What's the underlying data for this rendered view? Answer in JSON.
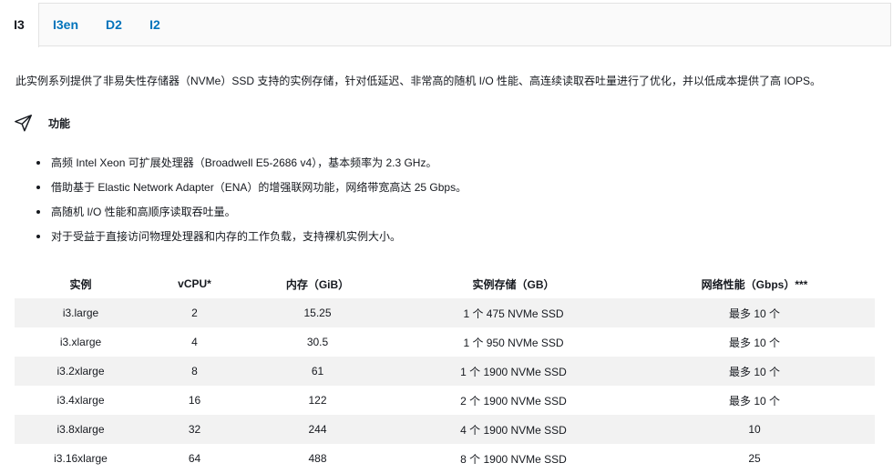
{
  "tabs": [
    {
      "label": "I3",
      "active": true
    },
    {
      "label": "I3en",
      "active": false
    },
    {
      "label": "D2",
      "active": false
    },
    {
      "label": "I2",
      "active": false
    }
  ],
  "intro": "此实例系列提供了非易失性存储器（NVMe）SSD 支持的实例存储，针对低延迟、非常高的随机 I/O 性能、高连续读取吞吐量进行了优化，并以低成本提供了高 IOPS。",
  "features": {
    "icon": "paper-plane-icon",
    "title": "功能",
    "items": [
      "高频 Intel Xeon 可扩展处理器（Broadwell E5-2686 v4），基本频率为 2.3 GHz。",
      "借助基于 Elastic Network Adapter（ENA）的增强联网功能，网络带宽高达 25 Gbps。",
      "高随机 I/O 性能和高顺序读取吞吐量。",
      "对于受益于直接访问物理处理器和内存的工作负载，支持裸机实例大小。"
    ]
  },
  "table": {
    "headers": [
      "实例",
      "vCPU*",
      "内存（GiB）",
      "实例存储（GB）",
      "网络性能（Gbps）***"
    ],
    "rows": [
      [
        "i3.large",
        "2",
        "15.25",
        "1 个 475 NVMe SSD",
        "最多 10 个"
      ],
      [
        "i3.xlarge",
        "4",
        "30.5",
        "1 个 950 NVMe SSD",
        "最多 10 个"
      ],
      [
        "i3.2xlarge",
        "8",
        "61",
        "1 个 1900 NVMe SSD",
        "最多 10 个"
      ],
      [
        "i3.4xlarge",
        "16",
        "122",
        "2 个 1900 NVMe SSD",
        "最多 10 个"
      ],
      [
        "i3.8xlarge",
        "32",
        "244",
        "4 个 1900 NVMe SSD",
        "10"
      ],
      [
        "i3.16xlarge",
        "64",
        "488",
        "8 个 1900 NVMe SSD",
        "25"
      ]
    ]
  },
  "colors": {
    "link": "#0073bb",
    "text": "#16191f",
    "row_shade": "#f2f2f2",
    "border": "#e3e3e3"
  }
}
